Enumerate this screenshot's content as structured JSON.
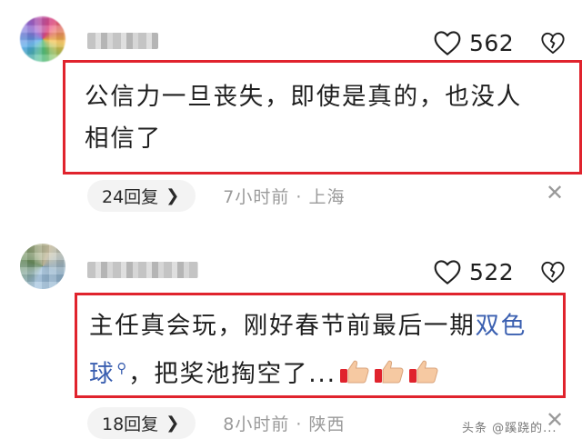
{
  "comments": [
    {
      "likes": "562",
      "text_lines": [
        "公信力一旦丧失，即使是真的，也没人",
        "相信了"
      ],
      "replies_label": "24回复",
      "time_location": "7小时前 · 上海"
    },
    {
      "likes": "522",
      "text_line1": "主任真会玩，刚好春节前最后一期",
      "link_word_a": "双色",
      "link_word_b": "球",
      "text_line2_after": "，把奖池掏空了...",
      "replies_label": "18回复",
      "time_location": "8小时前 · 陕西"
    }
  ],
  "icons": {
    "like": "heart-outline-icon",
    "dislike": "broken-heart-icon",
    "chevron": "chevron-right-icon",
    "close": "close-icon",
    "search": "search-icon",
    "thumbs": "thumbs-up-emoji"
  },
  "colors": {
    "highlight_box": "#e0232d",
    "link": "#3a5fb0",
    "meta_gray": "#9a9a9a"
  },
  "watermark": "头条 @蹊跷的..."
}
